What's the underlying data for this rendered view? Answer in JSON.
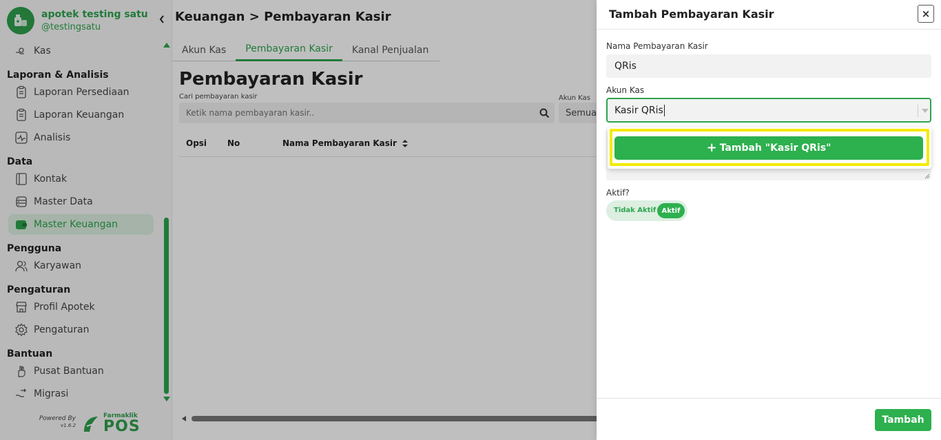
{
  "brand": {
    "name": "apotek testing satu",
    "username": "@testingsatu",
    "powered_by": "Powered By",
    "version": "v1.6.2",
    "logo_small": "Farmaklik",
    "logo_big": "POS"
  },
  "sidebar": {
    "items": [
      {
        "type": "item",
        "label": "Kas",
        "icon": "cash-hand-icon"
      },
      {
        "type": "section",
        "label": "Laporan & Analisis"
      },
      {
        "type": "item",
        "label": "Laporan Persediaan",
        "icon": "clipboard-icon"
      },
      {
        "type": "item",
        "label": "Laporan Keuangan",
        "icon": "clipboard-icon"
      },
      {
        "type": "item",
        "label": "Analisis",
        "icon": "activity-icon"
      },
      {
        "type": "section",
        "label": "Data"
      },
      {
        "type": "item",
        "label": "Kontak",
        "icon": "contact-book-icon"
      },
      {
        "type": "item",
        "label": "Master Data",
        "icon": "database-icon"
      },
      {
        "type": "item",
        "label": "Master Keuangan",
        "icon": "wallet-icon",
        "active": true
      },
      {
        "type": "section",
        "label": "Pengguna"
      },
      {
        "type": "item",
        "label": "Karyawan",
        "icon": "users-icon"
      },
      {
        "type": "section",
        "label": "Pengaturan"
      },
      {
        "type": "item",
        "label": "Profil Apotek",
        "icon": "store-icon"
      },
      {
        "type": "item",
        "label": "Pengaturan",
        "icon": "gear-icon"
      },
      {
        "type": "section",
        "label": "Bantuan"
      },
      {
        "type": "item",
        "label": "Pusat Bantuan",
        "icon": "help-hand-icon"
      },
      {
        "type": "item",
        "label": "Migrasi",
        "icon": "migrate-icon"
      }
    ]
  },
  "main": {
    "header": "Keuangan > Pembayaran Kasir",
    "tabs": [
      {
        "label": "Akun Kas",
        "active": false
      },
      {
        "label": "Pembayaran Kasir",
        "active": true
      },
      {
        "label": "Kanal Penjualan",
        "active": false
      }
    ],
    "title": "Pembayaran Kasir",
    "search_label": "Cari pembayaran kasir",
    "search_placeholder": "Ketik nama pembayaran kasir..",
    "akun_label": "Akun Kas",
    "akun_value": "Semua",
    "table_headers": [
      "Opsi",
      "No",
      "Nama Pembayaran Kasir"
    ]
  },
  "drawer": {
    "title": "Tambah Pembayaran Kasir",
    "close_label": "×",
    "name_label": "Nama Pembayaran Kasir",
    "name_value": "QRis",
    "akun_label": "Akun Kas",
    "akun_input": "Kasir QRis",
    "add_option_label": "Tambah \"Kasir QRis\"",
    "aktif_label": "Aktif?",
    "toggle_off": "Tidak Aktif",
    "toggle_on": "Aktif",
    "submit_label": "Tambah"
  },
  "colors": {
    "primary": "#2da44e",
    "highlight": "#f5ea00",
    "active_bg": "#dcefe1"
  }
}
